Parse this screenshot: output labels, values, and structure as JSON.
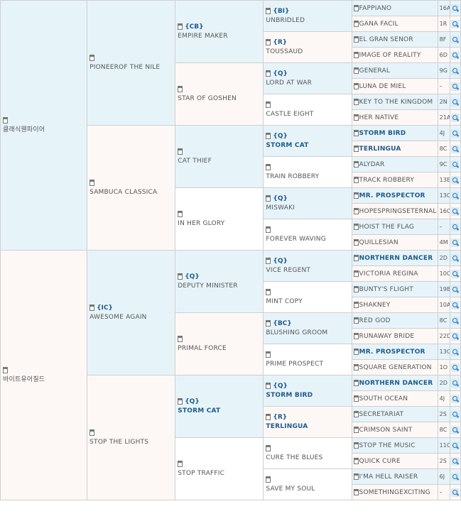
{
  "g1": [
    {
      "name": "클래식웬파이어",
      "code": "",
      "bold": false
    },
    {
      "name": "바이트유어칠드",
      "code": "",
      "bold": false
    }
  ],
  "g2": [
    {
      "name": "PIONEEROF THE NILE",
      "code": "",
      "bold": false
    },
    {
      "name": "SAMBUCA CLASSICA",
      "code": "",
      "bold": false
    },
    {
      "name": "AWESOME AGAIN",
      "code": "{IC}",
      "bold": false
    },
    {
      "name": "STOP THE LIGHTS",
      "code": "",
      "bold": false
    }
  ],
  "g3": [
    {
      "name": "EMPIRE MAKER",
      "code": "{CB}",
      "bold": false
    },
    {
      "name": "STAR OF GOSHEN",
      "code": "",
      "bold": false
    },
    {
      "name": "CAT THIEF",
      "code": "",
      "bold": false
    },
    {
      "name": "IN HER GLORY",
      "code": "",
      "bold": false
    },
    {
      "name": "DEPUTY MINISTER",
      "code": "{Q}",
      "bold": false
    },
    {
      "name": "PRIMAL FORCE",
      "code": "",
      "bold": false
    },
    {
      "name": "STORM CAT",
      "code": "{Q}",
      "bold": true
    },
    {
      "name": "STOP TRAFFIC",
      "code": "",
      "bold": false
    }
  ],
  "g4": [
    {
      "name": "UNBRIDLED",
      "code": "{BI}",
      "bold": false
    },
    {
      "name": "TOUSSAUD",
      "code": "{R}",
      "bold": false
    },
    {
      "name": "LORD AT WAR",
      "code": "{Q}",
      "bold": false
    },
    {
      "name": "CASTLE EIGHT",
      "code": "",
      "bold": false
    },
    {
      "name": "STORM CAT",
      "code": "{Q}",
      "bold": true
    },
    {
      "name": "TRAIN ROBBERY",
      "code": "",
      "bold": false
    },
    {
      "name": "MISWAKI",
      "code": "{Q}",
      "bold": false
    },
    {
      "name": "FOREVER WAVING",
      "code": "",
      "bold": false
    },
    {
      "name": "VICE REGENT",
      "code": "{Q}",
      "bold": false
    },
    {
      "name": "MINT COPY",
      "code": "",
      "bold": false
    },
    {
      "name": "BLUSHING GROOM",
      "code": "{BC}",
      "bold": false
    },
    {
      "name": "PRIME PROSPECT",
      "code": "",
      "bold": false
    },
    {
      "name": "STORM BIRD",
      "code": "{Q}",
      "bold": true
    },
    {
      "name": "TERLINGUA",
      "code": "{R}",
      "bold": true
    },
    {
      "name": "CURE THE BLUES",
      "code": "",
      "bold": false
    },
    {
      "name": "SAVE MY SOUL",
      "code": "",
      "bold": false
    }
  ],
  "g5": [
    {
      "name": "FAPPIANO",
      "num": "16A",
      "bold": false
    },
    {
      "name": "GANA FACIL",
      "num": "1R",
      "bold": false
    },
    {
      "name": "EL GRAN SENOR",
      "num": "8F",
      "bold": false
    },
    {
      "name": "IMAGE OF REALITY",
      "num": "6D",
      "bold": false
    },
    {
      "name": "GENERAL",
      "num": "9G",
      "bold": false
    },
    {
      "name": "LUNA DE MIEL",
      "num": "–",
      "bold": false
    },
    {
      "name": "KEY TO THE KINGDOM",
      "num": "2N",
      "bold": false
    },
    {
      "name": "HER NATIVE",
      "num": "21A",
      "bold": false
    },
    {
      "name": "STORM BIRD",
      "num": "4J",
      "bold": true
    },
    {
      "name": "TERLINGUA",
      "num": "8C",
      "bold": true
    },
    {
      "name": "ALYDAR",
      "num": "9C",
      "bold": false
    },
    {
      "name": "TRACK ROBBERY",
      "num": "13E",
      "bold": false
    },
    {
      "name": "MR. PROSPECTOR",
      "num": "13C",
      "bold": true
    },
    {
      "name": "HOPESPRINGSETERNAL",
      "num": "16C",
      "bold": false
    },
    {
      "name": "HOIST THE FLAG",
      "num": "–",
      "bold": false
    },
    {
      "name": "QUILLESIAN",
      "num": "4M",
      "bold": false
    },
    {
      "name": "NORTHERN DANCER",
      "num": "2D",
      "bold": true
    },
    {
      "name": "VICTORIA REGINA",
      "num": "10C",
      "bold": false
    },
    {
      "name": "BUNTY'S FLIGHT",
      "num": "19B",
      "bold": false
    },
    {
      "name": "SHAKNEY",
      "num": "10A",
      "bold": false
    },
    {
      "name": "RED GOD",
      "num": "8C",
      "bold": false
    },
    {
      "name": "RUNAWAY BRIDE",
      "num": "22D",
      "bold": false
    },
    {
      "name": "MR. PROSPECTOR",
      "num": "13C",
      "bold": true
    },
    {
      "name": "SQUARE GENERATION",
      "num": "1O",
      "bold": false
    },
    {
      "name": "NORTHERN DANCER",
      "num": "2D",
      "bold": true
    },
    {
      "name": "SOUTH OCEAN",
      "num": "4J",
      "bold": false
    },
    {
      "name": "SECRETARIAT",
      "num": "2S",
      "bold": false
    },
    {
      "name": "CRIMSON SAINT",
      "num": "8C",
      "bold": false
    },
    {
      "name": "STOP THE MUSIC",
      "num": "11C",
      "bold": false
    },
    {
      "name": "QUICK CURE",
      "num": "2S",
      "bold": false
    },
    {
      "name": "I'MA HELL RAISER",
      "num": "6J",
      "bold": false
    },
    {
      "name": "SOMETHINGEXCITING",
      "num": "–",
      "bold": false
    }
  ],
  "colors": {
    "g1": [
      "blue",
      "pink"
    ],
    "g2": [
      "blue",
      "pink",
      "blue",
      "pink"
    ],
    "g3": [
      "blue",
      "pink",
      "blue",
      "white",
      "blue",
      "pink",
      "blue",
      "white"
    ],
    "g4": [
      "blue",
      "pink",
      "blue",
      "white",
      "blue",
      "white",
      "blue",
      "white",
      "blue",
      "white",
      "blue",
      "white",
      "blue",
      "pink",
      "white",
      "white"
    ],
    "g5": [
      "blue",
      "pink",
      "blue",
      "pink",
      "blue",
      "pink",
      "blue",
      "pink",
      "blue",
      "pink",
      "blue",
      "pink",
      "blue",
      "pink",
      "blue",
      "pink",
      "blue",
      "pink",
      "blue",
      "pink",
      "blue",
      "pink",
      "blue",
      "pink",
      "blue",
      "pink",
      "blue",
      "pink",
      "blue",
      "pink",
      "blue",
      "pink"
    ]
  },
  "icons": {
    "doc": "document-icon",
    "search": "search-icon"
  }
}
